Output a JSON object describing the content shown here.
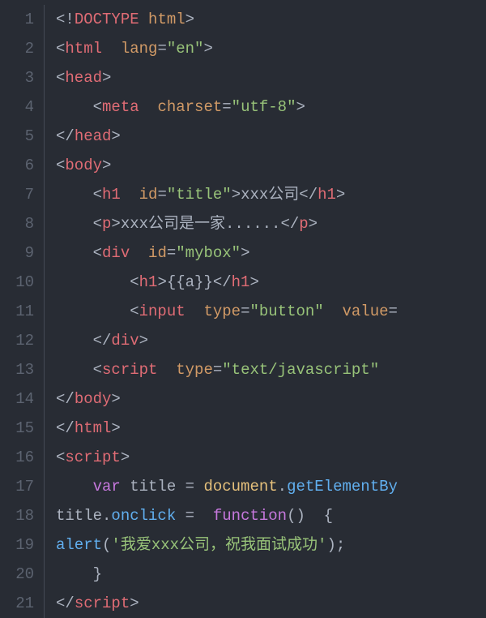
{
  "lines": [
    {
      "num": "1",
      "tokens": [
        {
          "t": "<!",
          "c": "pun"
        },
        {
          "t": "DOCTYPE",
          "c": "tag"
        },
        {
          "t": " ",
          "c": "pun"
        },
        {
          "t": "html",
          "c": "attr"
        },
        {
          "t": ">",
          "c": "pun"
        }
      ]
    },
    {
      "num": "2",
      "tokens": [
        {
          "t": "<",
          "c": "pun"
        },
        {
          "t": "html",
          "c": "tag"
        },
        {
          "t": "  ",
          "c": "pun"
        },
        {
          "t": "lang",
          "c": "attr"
        },
        {
          "t": "=",
          "c": "pun"
        },
        {
          "t": "\"en\"",
          "c": "str"
        },
        {
          "t": ">",
          "c": "pun"
        }
      ]
    },
    {
      "num": "3",
      "tokens": [
        {
          "t": "<",
          "c": "pun"
        },
        {
          "t": "head",
          "c": "tag"
        },
        {
          "t": ">",
          "c": "pun"
        }
      ]
    },
    {
      "num": "4",
      "tokens": [
        {
          "t": "    <",
          "c": "pun"
        },
        {
          "t": "meta",
          "c": "tag"
        },
        {
          "t": "  ",
          "c": "pun"
        },
        {
          "t": "charset",
          "c": "attr"
        },
        {
          "t": "=",
          "c": "pun"
        },
        {
          "t": "\"utf-8\"",
          "c": "str"
        },
        {
          "t": ">",
          "c": "pun"
        }
      ]
    },
    {
      "num": "5",
      "tokens": [
        {
          "t": "</",
          "c": "pun"
        },
        {
          "t": "head",
          "c": "tag"
        },
        {
          "t": ">",
          "c": "pun"
        }
      ]
    },
    {
      "num": "6",
      "tokens": [
        {
          "t": "<",
          "c": "pun"
        },
        {
          "t": "body",
          "c": "tag"
        },
        {
          "t": ">",
          "c": "pun"
        }
      ]
    },
    {
      "num": "7",
      "tokens": [
        {
          "t": "    <",
          "c": "pun"
        },
        {
          "t": "h1",
          "c": "tag"
        },
        {
          "t": "  ",
          "c": "pun"
        },
        {
          "t": "id",
          "c": "attr"
        },
        {
          "t": "=",
          "c": "pun"
        },
        {
          "t": "\"title\"",
          "c": "str"
        },
        {
          "t": ">xxx公司</",
          "c": "pun"
        },
        {
          "t": "h1",
          "c": "tag"
        },
        {
          "t": ">",
          "c": "pun"
        }
      ]
    },
    {
      "num": "8",
      "tokens": [
        {
          "t": "    <",
          "c": "pun"
        },
        {
          "t": "p",
          "c": "tag"
        },
        {
          "t": ">xxx公司是一家......</",
          "c": "pun"
        },
        {
          "t": "p",
          "c": "tag"
        },
        {
          "t": ">",
          "c": "pun"
        }
      ]
    },
    {
      "num": "9",
      "tokens": [
        {
          "t": "    <",
          "c": "pun"
        },
        {
          "t": "div",
          "c": "tag"
        },
        {
          "t": "  ",
          "c": "pun"
        },
        {
          "t": "id",
          "c": "attr"
        },
        {
          "t": "=",
          "c": "pun"
        },
        {
          "t": "\"mybox\"",
          "c": "str"
        },
        {
          "t": ">",
          "c": "pun"
        }
      ]
    },
    {
      "num": "10",
      "tokens": [
        {
          "t": "        <",
          "c": "pun"
        },
        {
          "t": "h1",
          "c": "tag"
        },
        {
          "t": ">{{a}}</",
          "c": "pun"
        },
        {
          "t": "h1",
          "c": "tag"
        },
        {
          "t": ">",
          "c": "pun"
        }
      ]
    },
    {
      "num": "11",
      "tokens": [
        {
          "t": "        <",
          "c": "pun"
        },
        {
          "t": "input",
          "c": "tag"
        },
        {
          "t": "  ",
          "c": "pun"
        },
        {
          "t": "type",
          "c": "attr"
        },
        {
          "t": "=",
          "c": "pun"
        },
        {
          "t": "\"button\"",
          "c": "str"
        },
        {
          "t": "  ",
          "c": "pun"
        },
        {
          "t": "value",
          "c": "attr"
        },
        {
          "t": "=",
          "c": "pun"
        }
      ]
    },
    {
      "num": "12",
      "tokens": [
        {
          "t": "    </",
          "c": "pun"
        },
        {
          "t": "div",
          "c": "tag"
        },
        {
          "t": ">",
          "c": "pun"
        }
      ]
    },
    {
      "num": "13",
      "tokens": [
        {
          "t": "    <",
          "c": "pun"
        },
        {
          "t": "script",
          "c": "tag"
        },
        {
          "t": "  ",
          "c": "pun"
        },
        {
          "t": "type",
          "c": "attr"
        },
        {
          "t": "=",
          "c": "pun"
        },
        {
          "t": "\"text/javascript\"",
          "c": "str"
        }
      ]
    },
    {
      "num": "14",
      "tokens": [
        {
          "t": "</",
          "c": "pun"
        },
        {
          "t": "body",
          "c": "tag"
        },
        {
          "t": ">",
          "c": "pun"
        }
      ]
    },
    {
      "num": "15",
      "tokens": [
        {
          "t": "</",
          "c": "pun"
        },
        {
          "t": "html",
          "c": "tag"
        },
        {
          "t": ">",
          "c": "pun"
        }
      ]
    },
    {
      "num": "16",
      "tokens": [
        {
          "t": "<",
          "c": "pun"
        },
        {
          "t": "script",
          "c": "tag"
        },
        {
          "t": ">",
          "c": "pun"
        }
      ]
    },
    {
      "num": "17",
      "tokens": [
        {
          "t": "    ",
          "c": "pun"
        },
        {
          "t": "var",
          "c": "kw"
        },
        {
          "t": " title = ",
          "c": "pun"
        },
        {
          "t": "document",
          "c": "id"
        },
        {
          "t": ".",
          "c": "pun"
        },
        {
          "t": "getElementBy",
          "c": "fn"
        }
      ]
    },
    {
      "num": "18",
      "tokens": [
        {
          "t": "title.",
          "c": "pun"
        },
        {
          "t": "onclick",
          "c": "fn"
        },
        {
          "t": " =  ",
          "c": "pun"
        },
        {
          "t": "function",
          "c": "kw"
        },
        {
          "t": "()  {",
          "c": "pun"
        }
      ]
    },
    {
      "num": "19",
      "tokens": [
        {
          "t": "alert",
          "c": "fn"
        },
        {
          "t": "(",
          "c": "pun"
        },
        {
          "t": "'我爱xxx公司，祝我面试成功'",
          "c": "str"
        },
        {
          "t": ");",
          "c": "pun"
        }
      ]
    },
    {
      "num": "20",
      "tokens": [
        {
          "t": "    }",
          "c": "pun"
        }
      ]
    },
    {
      "num": "21",
      "tokens": [
        {
          "t": "</",
          "c": "pun"
        },
        {
          "t": "script",
          "c": "tag"
        },
        {
          "t": ">",
          "c": "pun"
        }
      ]
    }
  ]
}
